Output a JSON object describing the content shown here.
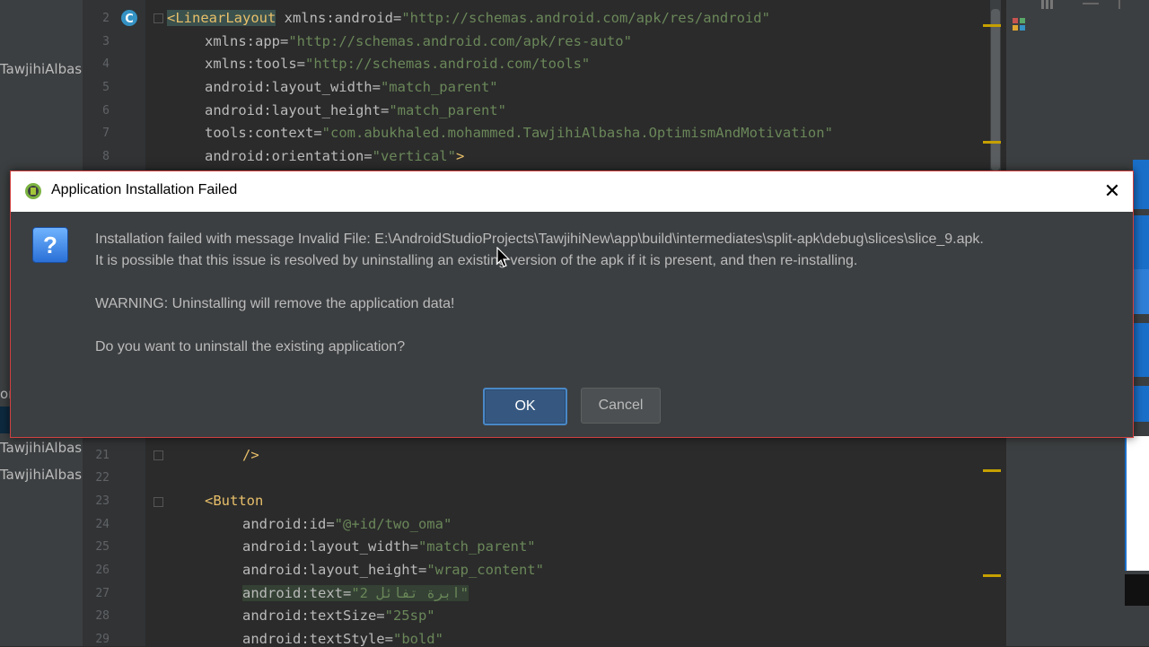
{
  "project_panel": {
    "items": [
      "TawjihiAlbas",
      "or",
      "TawjihiAlbas",
      "TawjihiAlbas"
    ]
  },
  "editor": {
    "line_numbers": [
      "2",
      "3",
      "4",
      "5",
      "6",
      "7",
      "8",
      "21",
      "22",
      "23",
      "24",
      "25",
      "26",
      "27",
      "28",
      "29"
    ],
    "lines": [
      {
        "indent": "",
        "tag": "<LinearLayout",
        "rest_attr": " xmlns:android=",
        "rest_val": "\"http://schemas.android.com/apk/res/android\""
      },
      {
        "attr": "xmlns:app=",
        "val": "\"http://schemas.android.com/apk/res-auto\""
      },
      {
        "attr": "xmlns:tools=",
        "val": "\"http://schemas.android.com/tools\""
      },
      {
        "attr": "android:layout_width=",
        "val": "\"match_parent\""
      },
      {
        "attr": "android:layout_height=",
        "val": "\"match_parent\""
      },
      {
        "attr": "tools:context=",
        "val": "\"com.abukhaled.mohammed.TawjihiAlbasha.OptimismAndMotivation\""
      },
      {
        "attr": "android:orientation=",
        "val": "\"vertical\"",
        "tail": ">"
      },
      {
        "tag": "/>"
      },
      {
        "tag": ""
      },
      {
        "tag": "<Button"
      },
      {
        "attr": "android:id=",
        "val": "\"@+id/two_oma\""
      },
      {
        "attr": "android:layout_width=",
        "val": "\"match_parent\""
      },
      {
        "attr": "android:layout_height=",
        "val": "\"wrap_content\""
      },
      {
        "attr": "android:text=",
        "val": "\"2 ابرة تفائل\""
      },
      {
        "attr": "android:textSize=",
        "val": "\"25sp\""
      },
      {
        "attr": "android:textStyle=",
        "val": "\"bold\""
      }
    ]
  },
  "dialog": {
    "title": "Application Installation Failed",
    "close_glyph": "✕",
    "question_glyph": "?",
    "message_line1": "Installation failed with message Invalid File: E:\\AndroidStudioProjects\\TawjihiNew\\app\\build\\intermediates\\split-apk\\debug\\slices\\slice_9.apk.",
    "message_line2": "It is possible that this issue is resolved by uninstalling an existing version of the apk if it is present, and then re-installing.",
    "warning": "WARNING: Uninstalling will remove the application data!",
    "question": "Do you want to uninstall the existing application?",
    "ok_label": "OK",
    "cancel_label": "Cancel"
  },
  "colors": {
    "editor_bg": "#2b2b2b",
    "tag": "#e8bf6a",
    "string_value": "#6a8759",
    "dialog_bg": "#3c3f41",
    "ok_button": "#365880"
  }
}
